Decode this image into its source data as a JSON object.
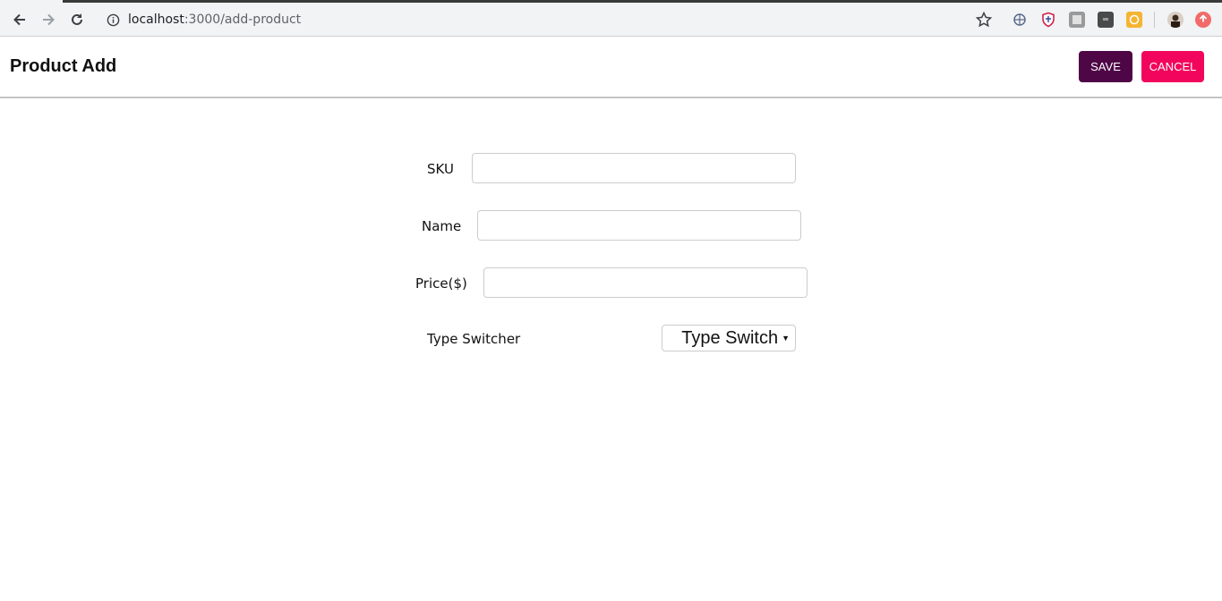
{
  "browser": {
    "url_host": "localhost",
    "url_path": ":3000/add-product",
    "icons": {
      "back": "arrow-left-icon",
      "forward": "arrow-right-icon",
      "reload": "reload-icon",
      "info": "info-icon",
      "bookmark": "star-icon"
    }
  },
  "header": {
    "title": "Product Add",
    "save_label": "SAVE",
    "cancel_label": "CANCEL"
  },
  "form": {
    "sku": {
      "label": "SKU",
      "value": ""
    },
    "name": {
      "label": "Name",
      "value": ""
    },
    "price": {
      "label": "Price($)",
      "value": ""
    },
    "type_switcher": {
      "label": "Type Switcher",
      "selected": "Type Switch"
    }
  },
  "colors": {
    "save_button": "#4e0646",
    "cancel_button": "#f2055c"
  }
}
